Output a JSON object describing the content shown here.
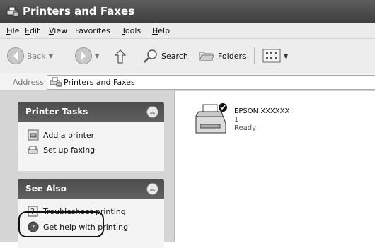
{
  "window": {
    "title": "Printers and Faxes"
  },
  "menu": {
    "file": {
      "first": "F",
      "rest": "ile"
    },
    "edit": {
      "first": "E",
      "rest": "dit"
    },
    "view": {
      "first": "V",
      "rest": "iew"
    },
    "favorites": {
      "first": "Favorites",
      "rest": ""
    },
    "tools": {
      "first": "T",
      "rest": "ools"
    },
    "help": {
      "first": "H",
      "rest": "elp"
    }
  },
  "toolbar": {
    "back": "Back",
    "search": "Search",
    "folders": "Folders"
  },
  "address": {
    "label": "Address",
    "value": "Printers and Faxes"
  },
  "printer_tasks": {
    "title": "Printer Tasks",
    "items": [
      {
        "label": "Add a printer",
        "icon": "add-printer-icon"
      },
      {
        "label": "Set up faxing",
        "icon": "fax-icon"
      }
    ]
  },
  "see_also": {
    "title": "See Also",
    "items": [
      {
        "label": "Troubleshoot printing",
        "icon": "help-book-icon"
      },
      {
        "label": "Get help with printing",
        "icon": "help-icon"
      }
    ]
  },
  "printer": {
    "name": "EPSON XXXXXX",
    "count": "1",
    "status": "Ready"
  }
}
